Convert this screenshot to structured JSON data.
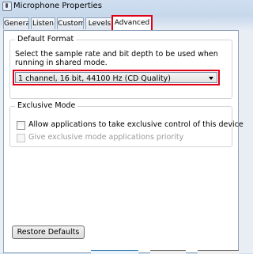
{
  "window": {
    "title": "Microphone Properties",
    "icon": "microphone-icon"
  },
  "tabs": [
    {
      "label": "General",
      "active": false
    },
    {
      "label": "Listen",
      "active": false
    },
    {
      "label": "Custom",
      "active": false
    },
    {
      "label": "Levels",
      "active": false
    },
    {
      "label": "Advanced",
      "active": true
    }
  ],
  "default_format": {
    "title": "Default Format",
    "description": "Select the sample rate and bit depth to be used when running in shared mode.",
    "selected_value": "1 channel, 16 bit, 44100 Hz (CD Quality)"
  },
  "exclusive_mode": {
    "title": "Exclusive Mode",
    "allow_label": "Allow applications to take exclusive control of this device",
    "allow_checked": false,
    "priority_label": "Give exclusive mode applications priority",
    "priority_checked": false,
    "priority_enabled": false
  },
  "buttons": {
    "restore_defaults": "Restore Defaults"
  },
  "colors": {
    "highlight": "#e00016",
    "panel": "#ffffff",
    "chrome": "#cfdff0"
  }
}
